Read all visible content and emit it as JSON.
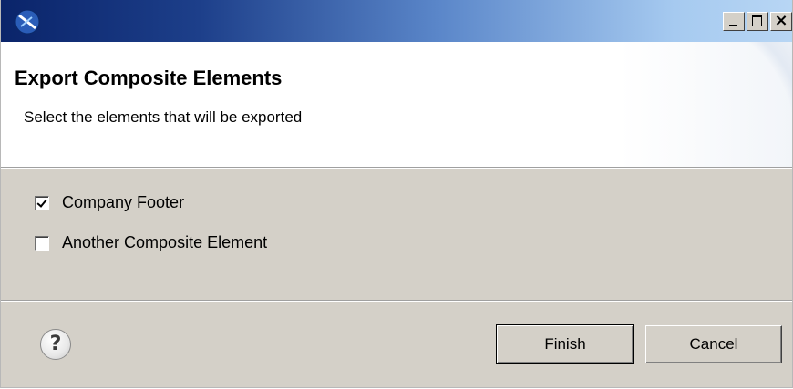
{
  "titlebar": {
    "icon": "eclipse-app-icon",
    "buttons": [
      "minimize",
      "maximize",
      "close"
    ],
    "close_glyph": "×"
  },
  "header": {
    "title": "Export Composite Elements",
    "description": "Select the elements that will be exported"
  },
  "elements": [
    {
      "label": "Company Footer",
      "checked": true
    },
    {
      "label": "Another Composite Element",
      "checked": false
    }
  ],
  "footer": {
    "help_glyph": "?",
    "finish_label": "Finish",
    "cancel_label": "Cancel"
  }
}
